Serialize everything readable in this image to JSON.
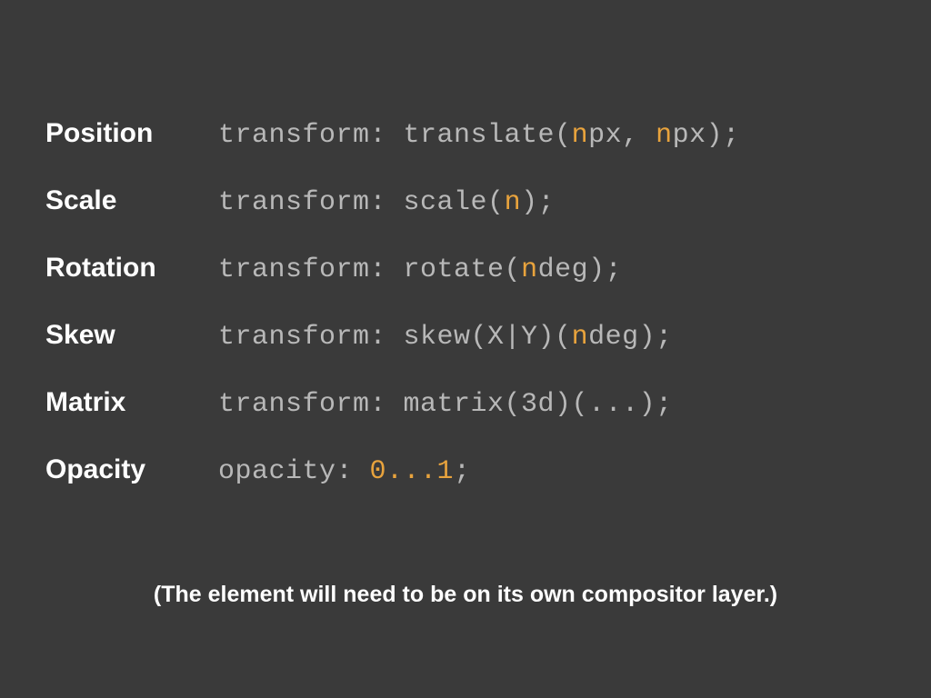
{
  "rows": [
    {
      "label": "Position",
      "code_html": "transform: translate(<span class=\"accent\">n</span>px, <span class=\"accent\">n</span>px);"
    },
    {
      "label": "Scale",
      "code_html": "transform: scale(<span class=\"accent\">n</span>);"
    },
    {
      "label": "Rotation",
      "code_html": "transform: rotate(<span class=\"accent\">n</span>deg);"
    },
    {
      "label": "Skew",
      "code_html": "transform: skew(X|Y)(<span class=\"accent\">n</span>deg);"
    },
    {
      "label": "Matrix",
      "code_html": "transform: matrix(3d)(...);"
    },
    {
      "label": "Opacity",
      "code_html": "opacity: <span class=\"accent\">0...1</span>;"
    }
  ],
  "footnote": "(The element will need to be on its own compositor layer.)"
}
